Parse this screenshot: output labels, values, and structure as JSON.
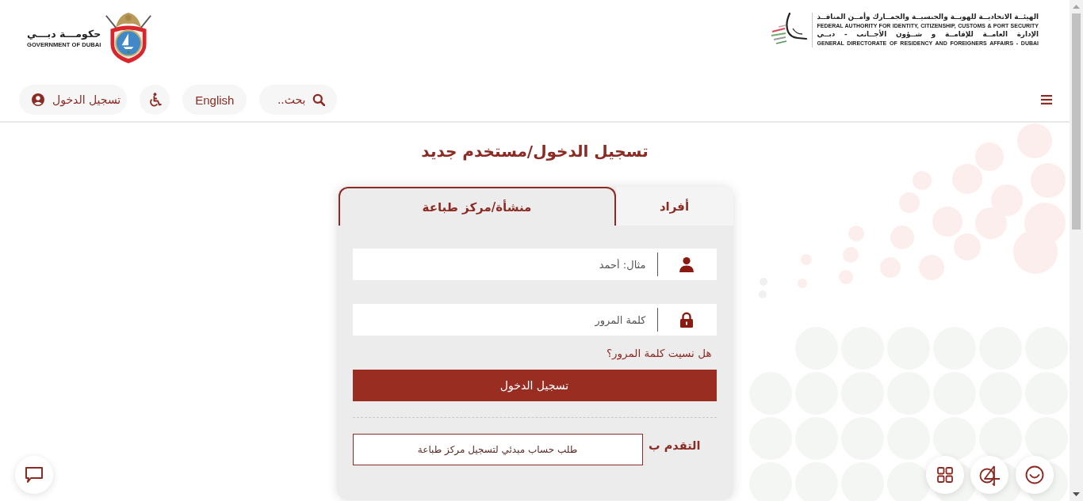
{
  "header": {
    "authority_logo": {
      "lines": [
        "الهيئــة الاتحاديــة للهويــة والجنسيــة والجمــارك وأمــن المنافــذ",
        "FEDERAL AUTHORITY FOR IDENTITY, CITIZENSHIP, CUSTOMS & PORT SECURITY",
        "الإدارة العامــة للإقامــة و شــؤون الأجــانب - دبــي",
        "GENERAL DIRECTORATE OF RESIDENCY AND FOREIGNERS AFFAIRS - DUBAI"
      ]
    },
    "government_logo": {
      "arabic": "حكومـــة دبـــي",
      "english": "GOVERNMENT OF DUBAI"
    },
    "search": {
      "placeholder": "بحث.."
    },
    "language_button": "English",
    "login_button": "تسجيل الدخول"
  },
  "page_title": "تسجيل الدخول/مستخدم جديد",
  "login_card": {
    "tabs": [
      {
        "label": "أفراد",
        "selected": false
      },
      {
        "label": "منشأة/مركز طباعة",
        "selected": true
      }
    ],
    "fields": [
      {
        "kind": "username",
        "placeholder": "مثال: أحمد"
      },
      {
        "kind": "password",
        "placeholder": "كلمة المرور"
      }
    ],
    "forgot_password_link": "هل نسيت كلمة المرور؟",
    "submit_button": "تسجيل الدخول",
    "apply_label": "التقدم ب",
    "apply_button": "طلب حساب مبدئي لتسجيل مركز طباعة"
  }
}
